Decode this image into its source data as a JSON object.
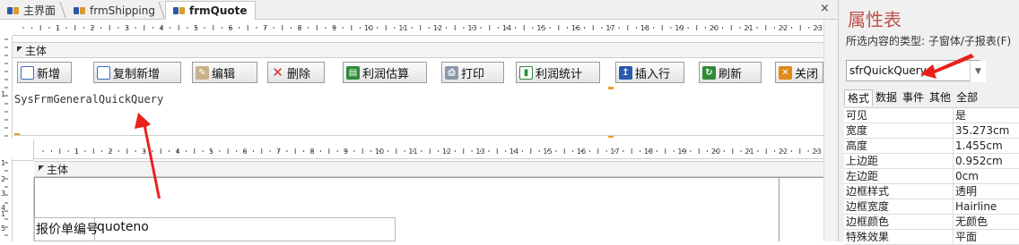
{
  "tabs": [
    {
      "label": "主界面",
      "active": false
    },
    {
      "label": "frmShipping",
      "active": false
    },
    {
      "label": "frmQuote",
      "active": true
    }
  ],
  "close_glyph": "×",
  "ruler_top": [
    "1",
    "2",
    "3",
    "4",
    "5",
    "6",
    "7",
    "8",
    "9",
    "10",
    "11",
    "12",
    "13",
    "14",
    "15",
    "16",
    "17",
    "18",
    "19",
    "20",
    "21",
    "22",
    "23"
  ],
  "ruler_mid": [
    "1",
    "2",
    "3",
    "4",
    "5",
    "6",
    "7",
    "8",
    "9",
    "10",
    "11",
    "12",
    "13",
    "14",
    "15",
    "16",
    "17",
    "18",
    "19",
    "20",
    "21",
    "22",
    "23"
  ],
  "vruler_top": [
    "1"
  ],
  "vruler_bottom": [
    "1",
    "2",
    "3",
    "4",
    "1",
    "5"
  ],
  "sections": {
    "main_top": "主体",
    "main_sub": "主体",
    "section_icon": "section-marker-icon"
  },
  "toolbar": [
    {
      "label": "新增",
      "icon": "new-doc-icon",
      "color": "#3b6fc2"
    },
    {
      "label": "复制新增",
      "icon": "copy-new-icon",
      "color": "#3b6fc2"
    },
    {
      "label": "编辑",
      "icon": "edit-icon",
      "color": "#7a5a3a"
    },
    {
      "label": "删除",
      "icon": "delete-icon",
      "color": "#d03030"
    },
    {
      "label": "利润估算",
      "icon": "calc-icon",
      "color": "#2e8b3a"
    },
    {
      "label": "打印",
      "icon": "print-icon",
      "color": "#6b7b8b"
    },
    {
      "label": "利润统计",
      "icon": "chart-icon",
      "color": "#2e8b3a"
    },
    {
      "label": "插入行",
      "icon": "insert-row-icon",
      "color": "#2a5aa8"
    },
    {
      "label": "刷新",
      "icon": "refresh-icon",
      "color": "#2e8b3a"
    },
    {
      "label": "关闭",
      "icon": "close-icon",
      "color": "#e08a1a"
    }
  ],
  "subform_name": "SysFrmGeneralQuickQuery",
  "field": {
    "label": "报价单编号",
    "value": "quoteno"
  },
  "panel": {
    "title": "属性表",
    "selection_type": "所选内容的类型: 子窗体/子报表(F)",
    "selected_control": "sfrQuickQuery",
    "tabs": [
      "格式",
      "数据",
      "事件",
      "其他",
      "全部"
    ],
    "active_tab": "格式",
    "properties": [
      {
        "name": "可见",
        "value": "是"
      },
      {
        "name": "宽度",
        "value": "35.273cm"
      },
      {
        "name": "高度",
        "value": "1.455cm"
      },
      {
        "name": "上边距",
        "value": "0.952cm"
      },
      {
        "name": "左边距",
        "value": "0cm"
      },
      {
        "name": "边框样式",
        "value": "透明"
      },
      {
        "name": "边框宽度",
        "value": "Hairline"
      },
      {
        "name": "边框颜色",
        "value": "无颜色"
      },
      {
        "name": "特殊效果",
        "value": "平面"
      }
    ]
  },
  "annotation_color": "#e8221b"
}
